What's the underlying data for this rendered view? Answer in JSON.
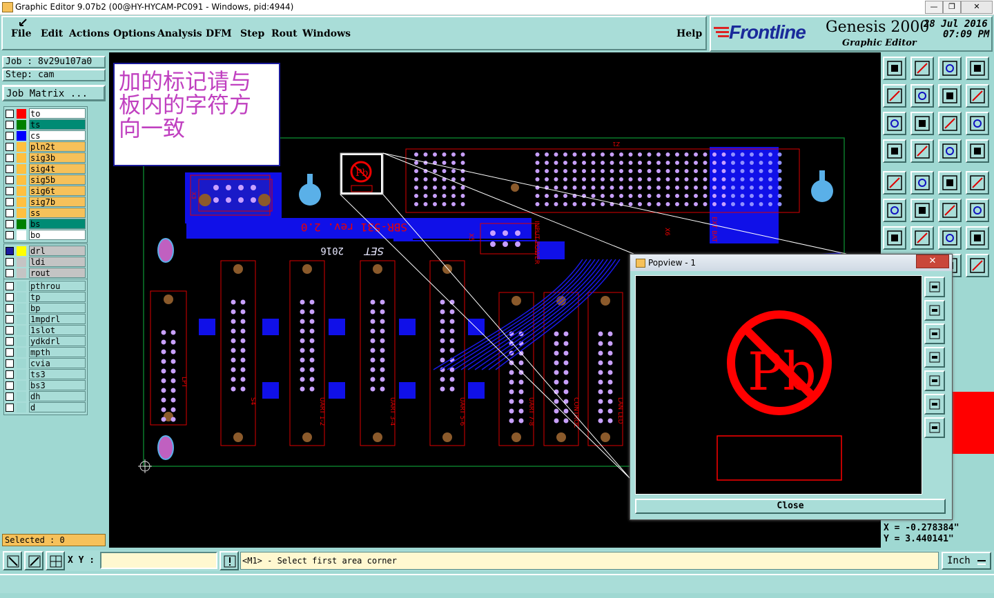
{
  "window": {
    "title": "Graphic Editor 9.07b2 (00@HY-HYCAM-PC091 - Windows, pid:4944)",
    "controls": [
      "—",
      "❐",
      "✕"
    ]
  },
  "menu": {
    "items": [
      "File",
      "Edit",
      "Actions",
      "Options",
      "Analysis",
      "DFM",
      "Step",
      "Rout",
      "Windows"
    ],
    "help": "Help"
  },
  "brand": {
    "logo": "Frontline",
    "product": "Genesis 2000",
    "subtitle": "Graphic Editor",
    "date": "28 Jul 2016",
    "time": "07:09 PM"
  },
  "job": {
    "job_label": "Job : 8v29u107a0",
    "step_label": "Step: cam",
    "matrix_button": "Job Matrix ..."
  },
  "layers": {
    "board": [
      {
        "name": "to",
        "color": "#ff0000",
        "bg": "#ffffff"
      },
      {
        "name": "ts",
        "color": "#008000",
        "bg": "#008b74"
      },
      {
        "name": "cs",
        "color": "#0000ff",
        "bg": "#ffffff"
      },
      {
        "name": "pln2t",
        "color": "#ffc040",
        "bg": "#f6c15a"
      },
      {
        "name": "sig3b",
        "color": "#ffc040",
        "bg": "#f6c15a"
      },
      {
        "name": "sig4t",
        "color": "#ffc040",
        "bg": "#f6c15a"
      },
      {
        "name": "sig5b",
        "color": "#ffc040",
        "bg": "#f6c15a"
      },
      {
        "name": "sig6t",
        "color": "#ffc040",
        "bg": "#f6c15a"
      },
      {
        "name": "sig7b",
        "color": "#ffc040",
        "bg": "#f6c15a"
      },
      {
        "name": "ss",
        "color": "#ffc040",
        "bg": "#f6c15a"
      },
      {
        "name": "bs",
        "color": "#008000",
        "bg": "#008b74"
      },
      {
        "name": "bo",
        "color": "#ffffff",
        "bg": "#ffffff"
      }
    ],
    "drill": [
      {
        "name": "drl",
        "color": "#ffff00",
        "bg": "#c4c4c4"
      },
      {
        "name": "ldi",
        "color": "#c4c4c4",
        "bg": "#c4c4c4"
      },
      {
        "name": "rout",
        "color": "#c4c4c4",
        "bg": "#c4c4c4"
      }
    ],
    "misc": [
      {
        "name": "pthrou"
      },
      {
        "name": "tp"
      },
      {
        "name": "bp"
      },
      {
        "name": "1mpdrl"
      },
      {
        "name": "1slot"
      },
      {
        "name": "ydkdrl"
      },
      {
        "name": "mpth"
      },
      {
        "name": "cvia"
      },
      {
        "name": "ts3"
      },
      {
        "name": "bs3"
      },
      {
        "name": "dh"
      },
      {
        "name": "d"
      }
    ]
  },
  "selected": "Selected : 0",
  "annotation_note": "加的标记请与板内的字符方向一致",
  "pcb": {
    "silk_texts": [
      "SBR-531 rev. 2.0",
      "2016",
      "SET",
      "INPUT POWER",
      "X5",
      "X6",
      "X3",
      "X11",
      "X18",
      "X9",
      "X8",
      "X4",
      "X1",
      "Z1",
      "S1",
      "S2",
      "S4",
      "UART 1-2",
      "UART 3-4",
      "UART 5-6",
      "UART 7-8",
      "CONTROL",
      "LAN LED",
      "LPT",
      "MIL-STD",
      "EXT BAT"
    ],
    "pb_label": "Pb"
  },
  "coordinates": {
    "x": "X = -0.278384\"",
    "y": "Y = 3.440141\""
  },
  "status": {
    "xy_label": "X Y :",
    "xy_value": "",
    "message": "<M1> - Select first area corner",
    "units": "Inch"
  },
  "popview": {
    "title": "Popview - 1",
    "symbol": "Pb",
    "close_button": "Close",
    "close_x": "✕"
  },
  "colors": {
    "panel": "#a9ddd8",
    "copper": "#0000ff",
    "silk": "#ff0000",
    "highlight": "#f6c15a"
  }
}
